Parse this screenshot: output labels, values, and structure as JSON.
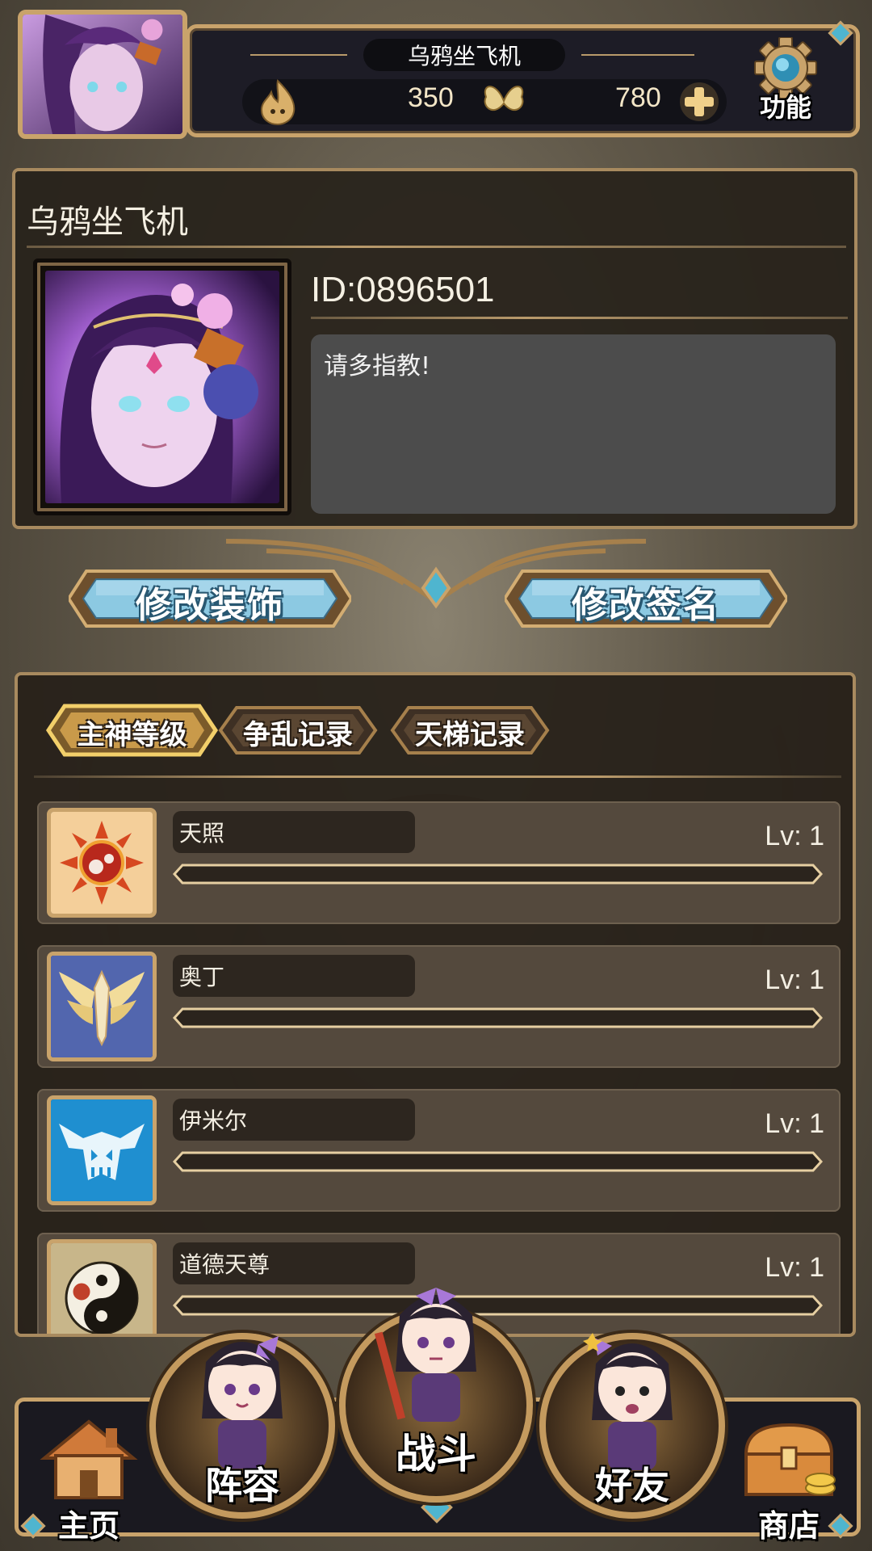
{
  "topbar": {
    "nickname": "乌鸦坐飞机",
    "currency_1": "350",
    "currency_2": "780",
    "function_label": "功能"
  },
  "profile": {
    "name": "乌鸦坐飞机",
    "id_text": "ID:0896501",
    "signature": "请多指教!"
  },
  "actions": {
    "edit_decoration": "修改装饰",
    "edit_signature": "修改签名"
  },
  "tabs": [
    {
      "label": "主神等级",
      "active": true
    },
    {
      "label": "争乱记录",
      "active": false
    },
    {
      "label": "天梯记录",
      "active": false
    }
  ],
  "gods": [
    {
      "name": "天照",
      "level": "Lv: 1"
    },
    {
      "name": "奥丁",
      "level": "Lv: 1"
    },
    {
      "name": "伊米尔",
      "level": "Lv: 1"
    },
    {
      "name": "道德天尊",
      "level": "Lv: 1"
    }
  ],
  "nav": {
    "home": "主页",
    "lineup": "阵容",
    "battle": "战斗",
    "friends": "好友",
    "shop": "商店"
  },
  "colors": {
    "gold_frame": "#c9a36b",
    "panel": "#28221b",
    "button_blue": "#7fc3e0",
    "gem": "#4fb5cf"
  }
}
